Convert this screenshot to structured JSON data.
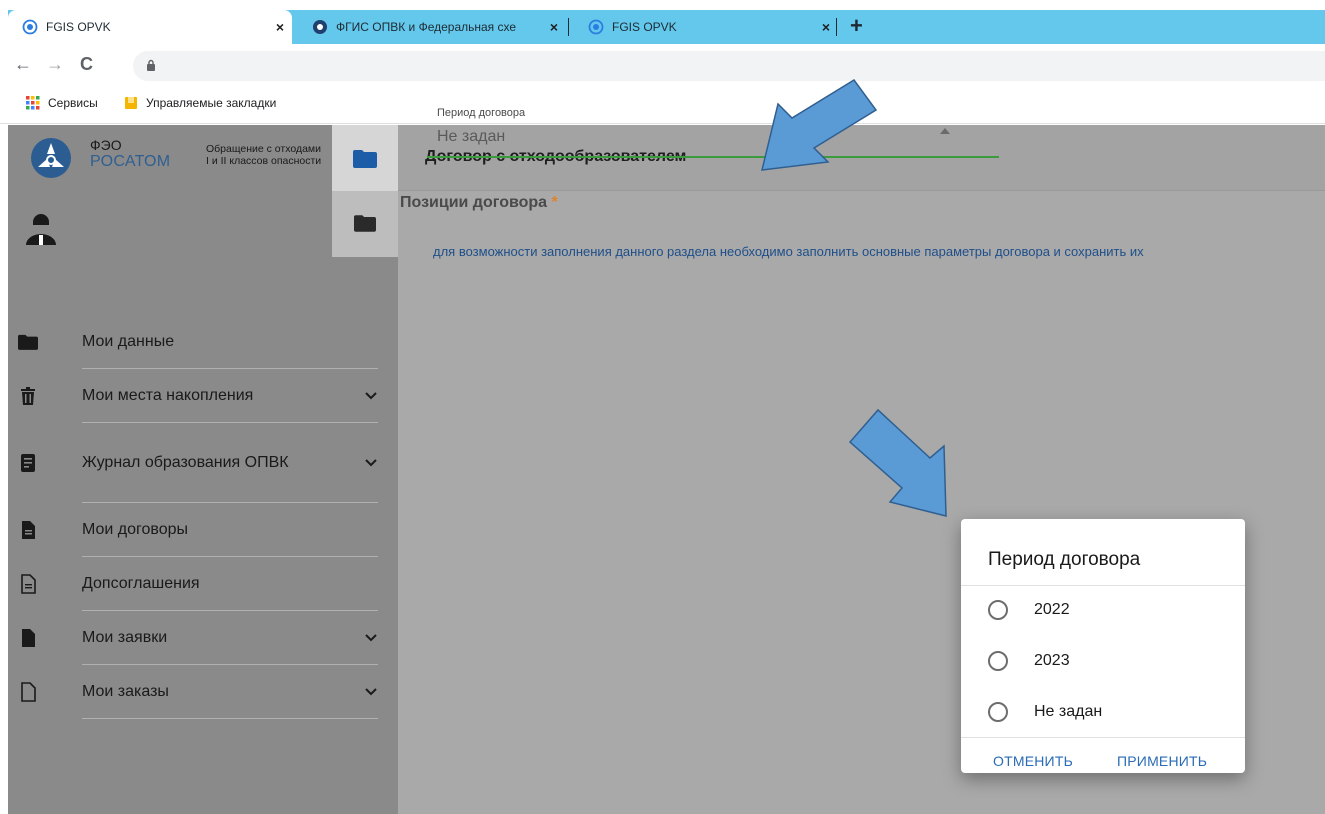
{
  "browser": {
    "tabs": [
      {
        "title": "FGIS OPVK",
        "close": "×"
      },
      {
        "title": "ФГИС ОПВК и Федеральная схе",
        "close": "×"
      },
      {
        "title": "FGIS OPVK",
        "close": "×"
      }
    ],
    "new_tab": "+",
    "nav": {
      "back": "←",
      "forward": "→",
      "reload": "C"
    },
    "bookmarks": [
      {
        "label": "Сервисы",
        "icon": "apps-grid-icon"
      },
      {
        "label": "Управляемые закладки",
        "icon": "bookmark-folder-icon"
      }
    ]
  },
  "brand": {
    "line1": "ФЭО",
    "line2": "РОСАТОМ",
    "desc_line1": "Обращение с отходами",
    "desc_line2": "I и II классов опасности"
  },
  "header": {
    "title": "Договор с отходообразователем"
  },
  "menu": [
    {
      "label": "Мои данные",
      "icon": "folder-icon",
      "chevron": false
    },
    {
      "label": "Мои места накопления",
      "icon": "trash-icon",
      "chevron": true
    },
    {
      "label": "Журнал образования ОПВК",
      "icon": "journal-icon",
      "chevron": true
    },
    {
      "label": "Мои договоры",
      "icon": "document-icon",
      "chevron": false
    },
    {
      "label": "Допсоглашения",
      "icon": "document-outline-icon",
      "chevron": false
    },
    {
      "label": "Мои заявки",
      "icon": "file-icon",
      "chevron": true
    },
    {
      "label": "Мои заказы",
      "icon": "file-outline-icon",
      "chevron": true
    }
  ],
  "form": {
    "period_label": "Период договора",
    "period_value": "Не задан",
    "positions_label": "Позиции договора",
    "required_mark": "*",
    "hint": "для возможности заполнения данного раздела необходимо заполнить основные параметры договора и сохранить их"
  },
  "dialog": {
    "title": "Период договора",
    "options": [
      "2022",
      "2023",
      "Не задан"
    ],
    "cancel": "ОТМЕНИТЬ",
    "apply": "ПРИМЕНИТЬ"
  },
  "colors": {
    "tabbar": "#63c8ec",
    "sidebar": "#8a8a8a",
    "content": "#a9a9a9",
    "accent_link": "#2a6bb5",
    "field_underline": "#3c9b3c",
    "required": "#e0822e",
    "annotation_arrow": "#5b9bd5"
  }
}
